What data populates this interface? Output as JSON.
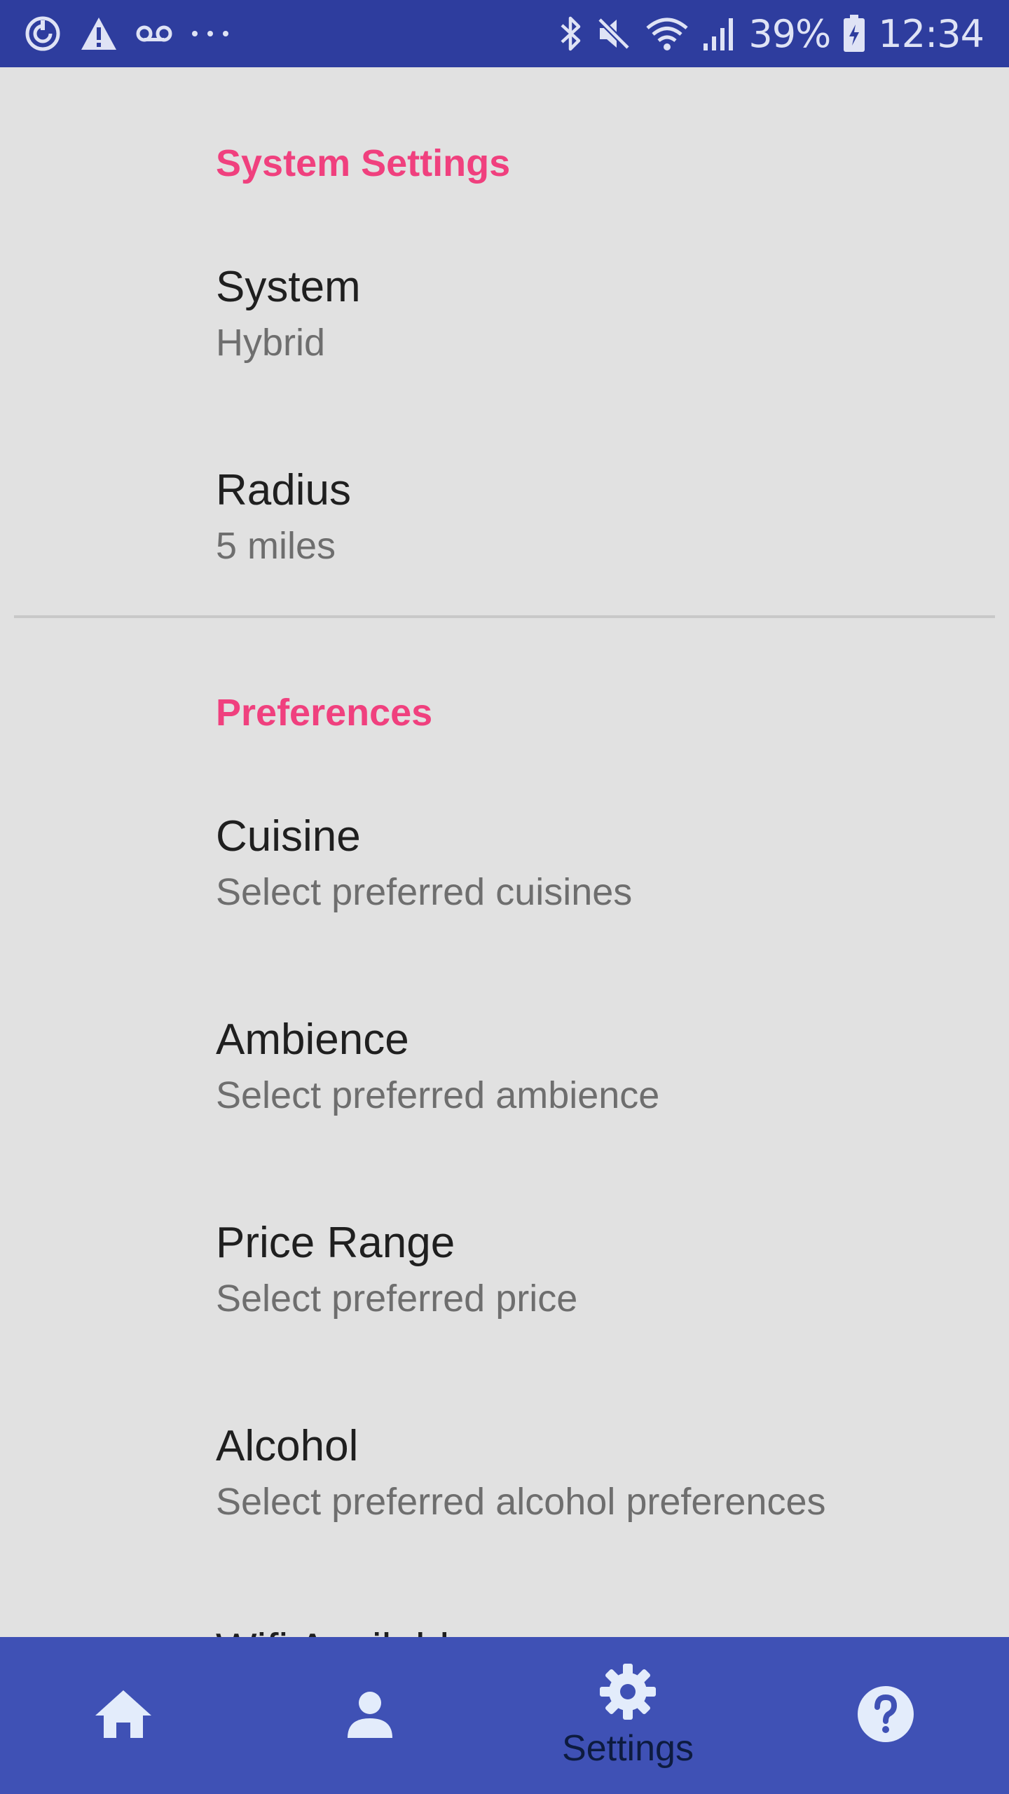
{
  "status_bar": {
    "left_icons": [
      "sync-icon",
      "warning-icon",
      "voicemail-icon",
      "more-dots-icon"
    ],
    "right_icons": [
      "bluetooth-icon",
      "mute-icon",
      "wifi-icon",
      "signal-icon"
    ],
    "battery_percent": "39%",
    "battery_icon": "battery-icon",
    "time": "12:34",
    "colors": {
      "background": "#2e3d9e",
      "foreground": "#dfe3f5"
    }
  },
  "sections": {
    "system": {
      "header": "System Settings",
      "items": [
        {
          "title": "System",
          "summary": "Hybrid"
        },
        {
          "title": "Radius",
          "summary": "5 miles"
        }
      ]
    },
    "preferences": {
      "header": "Preferences",
      "items": [
        {
          "title": "Cuisine",
          "summary": "Select preferred cuisines"
        },
        {
          "title": "Ambience",
          "summary": "Select preferred ambience"
        },
        {
          "title": "Price Range",
          "summary": "Select preferred price"
        },
        {
          "title": "Alcohol",
          "summary": "Select preferred alcohol preferences"
        },
        {
          "title": "Wifi Available",
          "summary": ""
        }
      ]
    }
  },
  "bottom_nav": {
    "items": [
      {
        "icon": "home-icon",
        "label": ""
      },
      {
        "icon": "person-icon",
        "label": ""
      },
      {
        "icon": "gear-icon",
        "label": "Settings",
        "selected": true
      },
      {
        "icon": "help-icon",
        "label": ""
      }
    ],
    "colors": {
      "background": "#3f51b5",
      "icon": "#e3ecfb",
      "selected_label": "#0d1b3f"
    }
  },
  "theme": {
    "background": "#e1e1e1",
    "accent": "#f0407e",
    "title_text": "#1f1f1f",
    "summary_text": "#6e6e6e"
  }
}
